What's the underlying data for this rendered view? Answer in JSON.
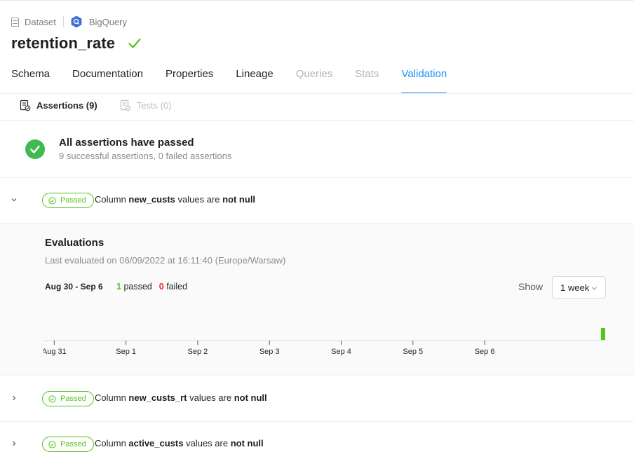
{
  "breadcrumb": {
    "dataset_label": "Dataset",
    "platform_label": "BigQuery",
    "dataset_icon": "table-icon",
    "platform_icon": "bigquery-icon"
  },
  "entity": {
    "name": "retention_rate",
    "status_icon": "check-icon"
  },
  "tabs": [
    {
      "label": "Schema",
      "state": "enabled"
    },
    {
      "label": "Documentation",
      "state": "enabled"
    },
    {
      "label": "Properties",
      "state": "enabled"
    },
    {
      "label": "Lineage",
      "state": "enabled"
    },
    {
      "label": "Queries",
      "state": "disabled"
    },
    {
      "label": "Stats",
      "state": "disabled"
    },
    {
      "label": "Validation",
      "state": "active"
    }
  ],
  "subtabs": [
    {
      "label": "Assertions (9)",
      "state": "active"
    },
    {
      "label": "Tests (0)",
      "state": "disabled"
    }
  ],
  "summary": {
    "title": "All assertions have passed",
    "subtitle": "9 successful assertions, 0 failed assertions"
  },
  "assertions": [
    {
      "badge": "Passed",
      "prefix": "Column ",
      "column": "new_custs",
      "middle": " values are ",
      "condition": "not null",
      "expanded": true
    },
    {
      "badge": "Passed",
      "prefix": "Column ",
      "column": "new_custs_rt",
      "middle": " values are ",
      "condition": "not null",
      "expanded": false
    },
    {
      "badge": "Passed",
      "prefix": "Column ",
      "column": "active_custs",
      "middle": " values are ",
      "condition": "not null",
      "expanded": false
    }
  ],
  "evaluations": {
    "title": "Evaluations",
    "last_evaluated": "Last evaluated on 06/09/2022 at 16:11:40 (Europe/Warsaw)",
    "range": "Aug 30 - Sep 6",
    "passed_count": "1",
    "passed_label": "passed",
    "failed_count": "0",
    "failed_label": "failed",
    "show_label": "Show",
    "show_value": "1 week"
  },
  "chart_data": {
    "type": "bar",
    "x_ticks": [
      "Aug 31",
      "Sep 1",
      "Sep 2",
      "Sep 3",
      "Sep 4",
      "Sep 5",
      "Sep 6"
    ],
    "series": [
      {
        "status": "passed",
        "color": "#52c41a",
        "x": [
          7.65
        ],
        "values": [
          1
        ]
      }
    ],
    "xlim": [
      -0.15,
      7.7
    ],
    "grid": false
  },
  "colors": {
    "accent": "#1890ff",
    "success": "#52c41a",
    "danger": "#f5222d"
  }
}
